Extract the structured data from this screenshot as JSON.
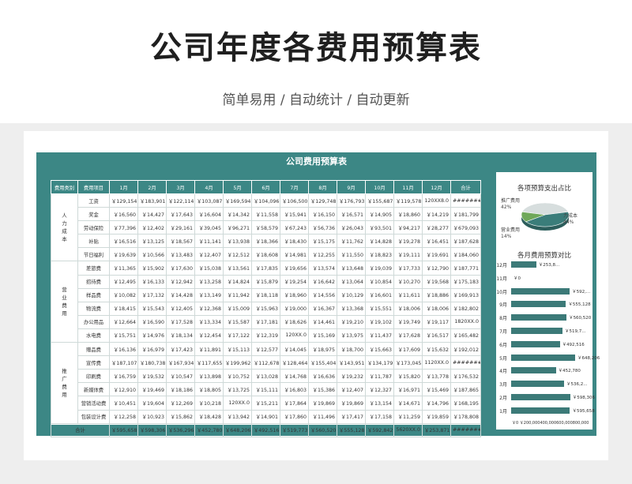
{
  "header": {
    "title": "公司年度各费用预算表",
    "subtitle": "简单易用 / 自动统计 / 自动更新"
  },
  "sheet": {
    "title": "公司费用预算表",
    "columns": [
      "费用类别",
      "费用项目",
      "1月",
      "2月",
      "3月",
      "4月",
      "5月",
      "6月",
      "7月",
      "8月",
      "9月",
      "10月",
      "11月",
      "12月",
      "合计"
    ],
    "groups": [
      {
        "category": "人力成本",
        "rows": [
          {
            "item": "工资",
            "values": [
              "￥129,154",
              "￥183,901",
              "￥122,114",
              "￥103,087",
              "￥169,594",
              "￥104,096",
              "￥106,500",
              "￥129,748",
              "￥176,793",
              "￥155,687",
              "￥119,578",
              "120XX8.0",
              "########"
            ]
          },
          {
            "item": "奖金",
            "values": [
              "￥16,560",
              "￥14,427",
              "￥17,643",
              "￥16,604",
              "￥14,342",
              "￥11,558",
              "￥15,941",
              "￥16,150",
              "￥16,571",
              "￥14,905",
              "￥18,860",
              "￥14,219",
              "￥181,799"
            ]
          },
          {
            "item": "劳动保险",
            "values": [
              "￥77,396",
              "￥12,402",
              "￥29,161",
              "￥39,045",
              "￥96,271",
              "￥58,579",
              "￥67,243",
              "￥56,736",
              "￥26,043",
              "￥93,501",
              "￥94,217",
              "￥28,277",
              "￥679,093"
            ]
          },
          {
            "item": "补贴",
            "values": [
              "￥16,516",
              "￥13,125",
              "￥18,567",
              "￥11,141",
              "￥13,938",
              "￥18,366",
              "￥18,430",
              "￥15,175",
              "￥11,762",
              "￥14,828",
              "￥19,278",
              "￥16,451",
              "￥187,628"
            ]
          },
          {
            "item": "节日福利",
            "values": [
              "￥19,639",
              "￥10,566",
              "￥13,483",
              "￥12,407",
              "￥12,512",
              "￥18,608",
              "￥14,981",
              "￥12,255",
              "￥11,550",
              "￥18,823",
              "￥19,111",
              "￥19,691",
              "￥184,060"
            ]
          }
        ]
      },
      {
        "category": "营业费用",
        "rows": [
          {
            "item": "差旅费",
            "values": [
              "￥11,365",
              "￥15,902",
              "￥17,630",
              "￥15,038",
              "￥13,561",
              "￥17,835",
              "￥19,656",
              "￥13,574",
              "￥13,648",
              "￥19,039",
              "￥17,733",
              "￥12,790",
              "￥187,771"
            ]
          },
          {
            "item": "招待费",
            "values": [
              "￥12,495",
              "￥16,133",
              "￥12,942",
              "￥13,258",
              "￥14,824",
              "￥15,879",
              "￥19,254",
              "￥16,642",
              "￥13,064",
              "￥10,854",
              "￥10,270",
              "￥19,568",
              "￥175,183"
            ]
          },
          {
            "item": "样品费",
            "values": [
              "￥10,082",
              "￥17,132",
              "￥14,428",
              "￥13,149",
              "￥11,942",
              "￥18,118",
              "￥18,960",
              "￥14,556",
              "￥10,129",
              "￥16,601",
              "￥11,611",
              "￥18,886",
              "￥169,913"
            ]
          },
          {
            "item": "物流费",
            "values": [
              "￥18,415",
              "￥15,543",
              "￥12,405",
              "￥12,368",
              "￥15,009",
              "￥15,963",
              "￥19,000",
              "￥16,367",
              "￥13,368",
              "￥15,551",
              "￥18,006",
              "￥18,006",
              "￥182,802"
            ]
          },
          {
            "item": "办公用品",
            "values": [
              "￥12,664",
              "￥16,590",
              "￥17,528",
              "￥13,334",
              "￥15,587",
              "￥17,181",
              "￥18,626",
              "￥14,461",
              "￥19,210",
              "￥19,102",
              "￥19,749",
              "￥19,117",
              "1820XX.0"
            ]
          },
          {
            "item": "水电费",
            "values": [
              "￥15,751",
              "￥14,976",
              "￥18,134",
              "￥12,454",
              "￥17,122",
              "￥12,319",
              "120XX.0",
              "￥15,169",
              "￥13,975",
              "￥11,437",
              "￥17,628",
              "￥16,517",
              "￥165,482"
            ]
          }
        ]
      },
      {
        "category": "推广费用",
        "rows": [
          {
            "item": "赠品费",
            "values": [
              "￥16,136",
              "￥16,979",
              "￥17,423",
              "￥11,891",
              "￥15,113",
              "￥12,577",
              "￥14,045",
              "￥18,975",
              "￥18,700",
              "￥15,663",
              "￥17,609",
              "￥15,632",
              "￥192,012"
            ]
          },
          {
            "item": "宣传费",
            "values": [
              "￥187,107",
              "￥180,738",
              "￥167,934",
              "￥117,655",
              "￥199,962",
              "￥112,678",
              "￥128,464",
              "￥155,404",
              "￥143,951",
              "￥134,179",
              "￥173,045",
              "1120XX.0",
              "########"
            ]
          },
          {
            "item": "印刷费",
            "values": [
              "￥16,759",
              "￥19,532",
              "￥10,547",
              "￥13,898",
              "￥10,752",
              "￥13,028",
              "￥14,768",
              "￥16,636",
              "￥19,232",
              "￥11,787",
              "￥15,820",
              "￥13,778",
              "￥176,532"
            ]
          },
          {
            "item": "新媒体费",
            "values": [
              "￥12,910",
              "￥19,469",
              "￥18,186",
              "￥18,805",
              "￥13,725",
              "￥15,111",
              "￥16,803",
              "￥15,386",
              "￥12,407",
              "￥12,327",
              "￥16,971",
              "￥15,469",
              "￥187,865"
            ]
          },
          {
            "item": "营销活动费",
            "values": [
              "￥10,451",
              "￥19,604",
              "￥12,269",
              "￥10,218",
              "120XX.0",
              "￥15,211",
              "￥17,864",
              "￥19,869",
              "￥19,869",
              "￥13,154",
              "￥14,671",
              "￥14,796",
              "￥168,195"
            ]
          },
          {
            "item": "包装设计费",
            "values": [
              "￥12,258",
              "￥10,923",
              "￥15,862",
              "￥18,428",
              "￥13,942",
              "￥14,901",
              "￥17,860",
              "￥11,496",
              "￥17,417",
              "￥17,158",
              "￥11,259",
              "￥19,859",
              "￥178,808"
            ]
          }
        ]
      }
    ],
    "total_row": {
      "label": "合计",
      "values": [
        "￥595,658",
        "￥598,306",
        "￥536,296",
        "￥452,780",
        "￥648,206",
        "￥492,516",
        "￥519,773",
        "￥560,520",
        "￥555,128",
        "￥592,842",
        "5620XX.0",
        "￥253,871",
        "########"
      ]
    }
  },
  "colors": {
    "accent": "#3c8785",
    "bar": "#3c7a78",
    "pie_gray": "#d7dede",
    "pie_green": "#6fa85a",
    "pie_teal": "#3a7d7a"
  },
  "chart_data": [
    {
      "type": "pie",
      "title": "各项预算支出占比",
      "labels": [
        "推广费用",
        "人力成本",
        "营业费用"
      ],
      "values": [
        42,
        44,
        14
      ],
      "label_text": [
        "推广费用\n42%",
        "力成本\n44%",
        "营业费用\n14%"
      ]
    },
    {
      "type": "bar",
      "title": "各月费用预算对比",
      "categories": [
        "12月",
        "11月",
        "10月",
        "9月",
        "8月",
        "7月",
        "6月",
        "5月",
        "4月",
        "3月",
        "2月",
        "1月"
      ],
      "values": [
        253871,
        0,
        592842,
        555128,
        560520,
        519773,
        492516,
        648206,
        452780,
        536296,
        598306,
        595658
      ],
      "value_labels": [
        "￥253,8...",
        "￥0",
        "￥592,...",
        "￥555,128",
        "￥560,520",
        "￥519,7...",
        "￥492,516",
        "￥648,206",
        "￥452,780",
        "￥536,2...",
        "￥598,306",
        "￥595,658"
      ],
      "x_axis_text": "￥0 ￥200,000400,000600,000800,000",
      "xlim": [
        0,
        800000
      ]
    }
  ]
}
